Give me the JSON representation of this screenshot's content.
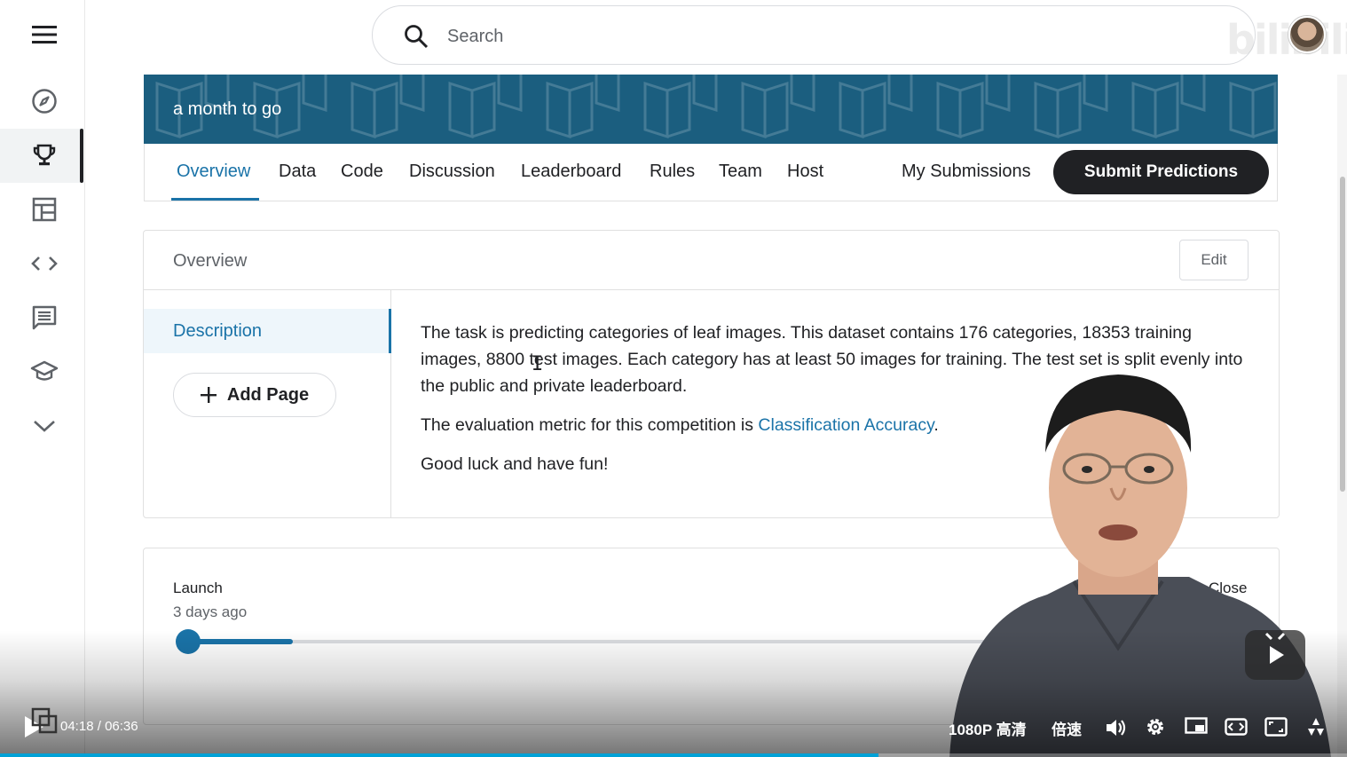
{
  "search": {
    "placeholder": "Search"
  },
  "watermark": "bilibili",
  "banner": {
    "text": "a month to go"
  },
  "tabs": [
    {
      "label": "Overview"
    },
    {
      "label": "Data"
    },
    {
      "label": "Code"
    },
    {
      "label": "Discussion"
    },
    {
      "label": "Leaderboard"
    },
    {
      "label": "Rules"
    },
    {
      "label": "Team"
    },
    {
      "label": "Host"
    },
    {
      "label": "My Submissions"
    }
  ],
  "submit_label": "Submit Predictions",
  "overview": {
    "title": "Overview",
    "edit_label": "Edit",
    "nav": {
      "description": "Description",
      "add_page": "Add Page"
    },
    "para1": "The task is predicting categories of leaf images. This dataset contains 176 categories, 18353 training images, 8800 test images. Each category has at least 50 images for training. The test set is split evenly into the public and private leaderboard.",
    "para2_prefix": "The evaluation metric for this competition is ",
    "para2_link": "Classification Accuracy",
    "para2_suffix": ".",
    "para3": "Good luck and have fun!"
  },
  "timeline": {
    "start_label": "Launch",
    "start_sub": "3 days ago",
    "end_label": "Close",
    "progress": 0.1
  },
  "player": {
    "current_time": "04:18",
    "separator": "/",
    "duration": "06:36",
    "quality": "1080P 高清",
    "speed": "倍速",
    "played_fraction": 0.652
  },
  "colors": {
    "accent": "#1a73a8",
    "banner": "#1b5e7f",
    "button_dark": "#202124",
    "player_progress": "#00a1d6"
  },
  "icons": [
    "menu-icon",
    "compass-icon",
    "trophy-icon",
    "table-icon",
    "code-icon",
    "comments-icon",
    "school-icon",
    "chevron-down-icon",
    "search-icon",
    "plus-icon",
    "play-icon",
    "volume-icon",
    "gear-icon",
    "pip-icon",
    "widescreen-icon",
    "fullscreen-icon"
  ]
}
